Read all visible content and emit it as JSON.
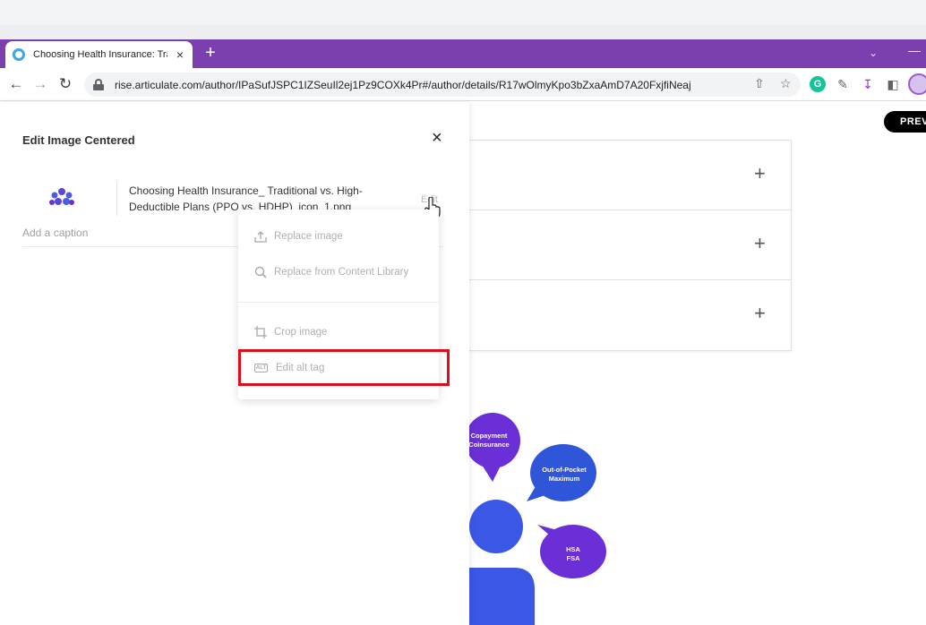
{
  "browser": {
    "tab_title": "Choosing Health Insurance: Trad",
    "tab_close": "×",
    "new_tab": "+",
    "url": "rise.articulate.com/author/IPaSufJSPC1IZSeuIl2ej1Pz9COXk4Pr#/author/details/R17wOlmyKpo3bZxaAmD7A20FxjfiNeaj"
  },
  "header": {
    "preview_label": "PREV"
  },
  "panel": {
    "title": "Edit Image Centered",
    "close": "×",
    "file_name": "Choosing Health Insurance_ Traditional vs. High-Deductible Plans (PPO vs. HDHP)_icon_1.png",
    "edit_label": "Edit",
    "caption_placeholder": "Add a caption"
  },
  "menu": {
    "items": [
      {
        "label": "Replace image",
        "icon": "upload-icon"
      },
      {
        "label": "Replace from Content Library",
        "icon": "search-icon"
      },
      {
        "label": "Crop image",
        "icon": "crop-icon"
      },
      {
        "label": "Edit alt tag",
        "icon": "alt-tag-icon",
        "badge": "ALT",
        "highlighted": true
      }
    ]
  },
  "accordion": {
    "expand_symbol": "+"
  },
  "illustration": {
    "bubbles": [
      "Copayment\nCoinsurance",
      "Out-of-Pocket\nMaximum",
      "HSA\nFSA"
    ]
  },
  "colors": {
    "tabbar": "#7b3fb0",
    "highlight": "#e00b1c",
    "bubble_purple": "#6a2fd6",
    "person_blue": "#3b57e6"
  }
}
